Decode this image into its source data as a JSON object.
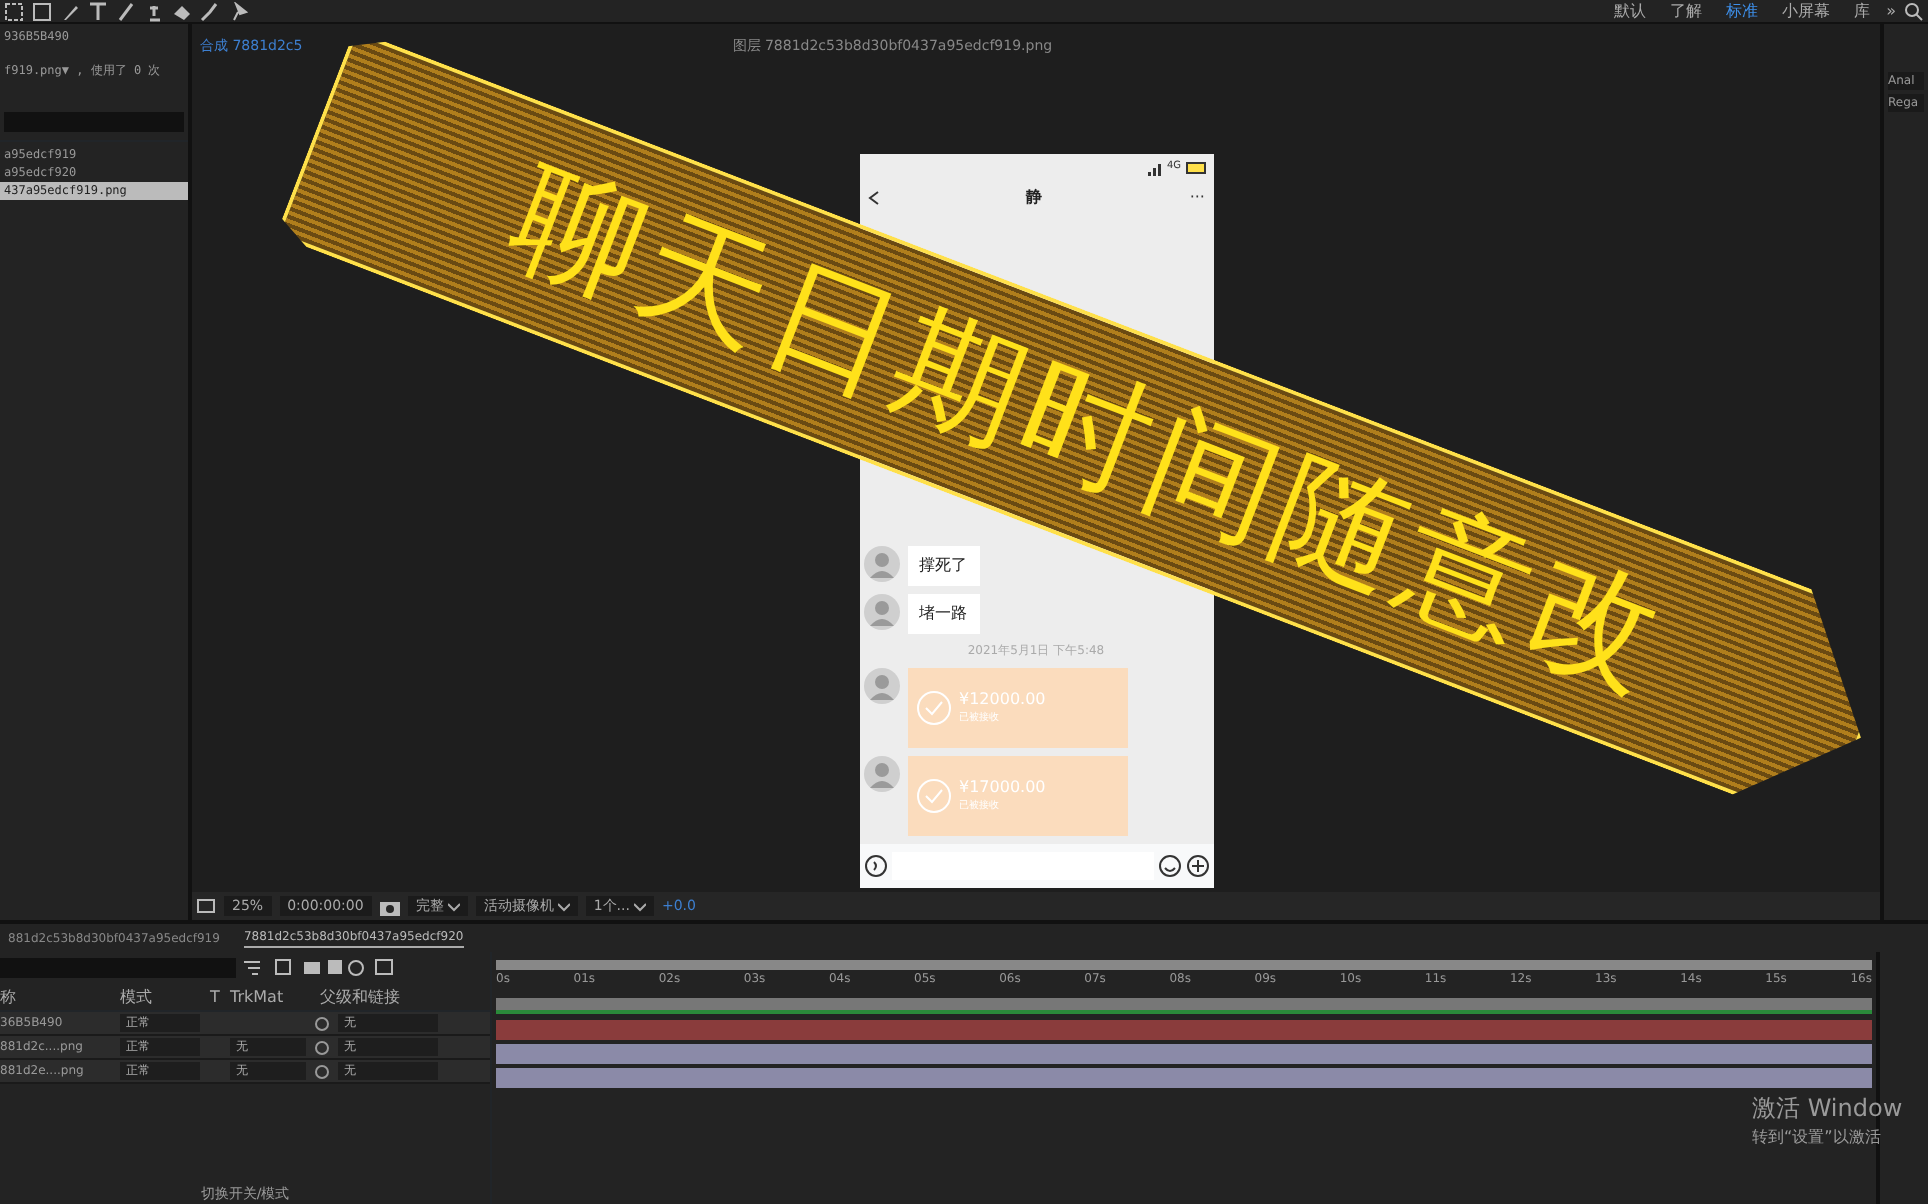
{
  "workspaces": [
    {
      "label": "默认",
      "selected": false
    },
    {
      "label": "了解",
      "selected": false
    },
    {
      "label": "标准",
      "selected": true
    },
    {
      "label": "小屏幕",
      "selected": false
    },
    {
      "label": "库",
      "selected": false
    }
  ],
  "workspace_more": "»",
  "project": {
    "lines": [
      "936B5B490",
      "f919.png▼ , 使用了 0 次"
    ],
    "items": [
      {
        "label": "a95edcf919",
        "selected": false
      },
      {
        "label": "a95edcf920",
        "selected": false
      },
      {
        "label": "437a95edcf919.png",
        "selected": true
      }
    ]
  },
  "viewer": {
    "tabs": [
      {
        "label": "合成 7881d2c5",
        "selected": true
      },
      {
        "label": "图层 7881d2c53b8d30bf0437a95edcf919.png",
        "selected": false
      }
    ],
    "toolbar": {
      "zoom": "25%",
      "timecode": "0:00:00:00",
      "resolution": "完整",
      "camera": "活动摄像机",
      "views": "1个...",
      "exposure": "+0.0"
    }
  },
  "phone": {
    "status": "4G",
    "title": "静",
    "more": "···",
    "messages": [
      {
        "kind": "text",
        "text": "撑死了"
      },
      {
        "kind": "text",
        "text": "堵一路"
      },
      {
        "kind": "time",
        "text": "2021年5月1日 下午5:48"
      },
      {
        "kind": "transfer",
        "amount": "¥12000.00",
        "note": "已被接收"
      },
      {
        "kind": "transfer",
        "amount": "¥17000.00",
        "note": "已被接收"
      }
    ]
  },
  "right_panel": {
    "fonts": [
      "Anal",
      "Rega"
    ]
  },
  "timeline": {
    "tabs": [
      {
        "label": "881d2c53b8d30bf0437a95edcf919",
        "selected": false
      },
      {
        "label": "7881d2c53b8d30bf0437a95edcf920",
        "selected": true
      }
    ],
    "columns": [
      "称",
      "模式",
      "T",
      "TrkMat",
      "父级和链接"
    ],
    "layers": [
      {
        "name": "36B5B490",
        "mode": "正常",
        "parent": "无",
        "color": "#8a3c3c"
      },
      {
        "name": "881d2c....png",
        "mode": "正常",
        "trkmat": "无",
        "parent": "无",
        "color": "#8b8aa8"
      },
      {
        "name": "881d2e....png",
        "mode": "正常",
        "trkmat": "无",
        "parent": "无",
        "color": "#8b8aa8"
      }
    ],
    "ruler": [
      "0s",
      "01s",
      "02s",
      "03s",
      "04s",
      "05s",
      "06s",
      "07s",
      "08s",
      "09s",
      "10s",
      "11s",
      "12s",
      "13s",
      "14s",
      "15s",
      "16s"
    ],
    "footer": "切换开关/模式"
  },
  "banner": "聊天日期时间随意改",
  "activation": {
    "title": "激活 Window",
    "hint": "转到“设置”以激活"
  }
}
